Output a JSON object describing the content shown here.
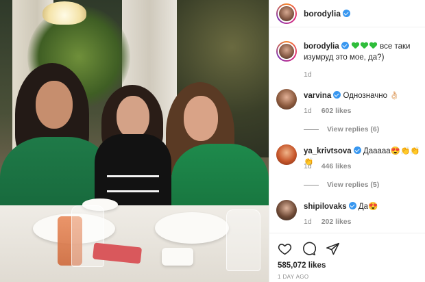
{
  "post": {
    "author": "borodylia",
    "verified": true,
    "caption": {
      "username": "borodylia",
      "emoji": "💚💚💚",
      "text_line1": "все таки",
      "text_line2": "изумруд это мое, да?)",
      "time": "1d"
    }
  },
  "comments": [
    {
      "username": "varvina",
      "verified": true,
      "text": "Однозначно 👌🏻",
      "time": "1d",
      "likes": "602 likes",
      "replies": "View replies (6)"
    },
    {
      "username": "ya_krivtsova",
      "verified": true,
      "text": "Дааааа😍👏👏👏",
      "time": "1d",
      "likes": "446 likes",
      "replies": "View replies (5)"
    },
    {
      "username": "shipilovaks",
      "verified": true,
      "text": "Да😍",
      "time": "1d",
      "likes": "202 likes"
    }
  ],
  "footer": {
    "likes": "585,072 likes",
    "posted": "1 DAY AGO"
  },
  "colors": {
    "verified": "#3897f0",
    "muted": "#8e8e8e",
    "text": "#262626",
    "heart_emoji": "#2ebd3a"
  }
}
